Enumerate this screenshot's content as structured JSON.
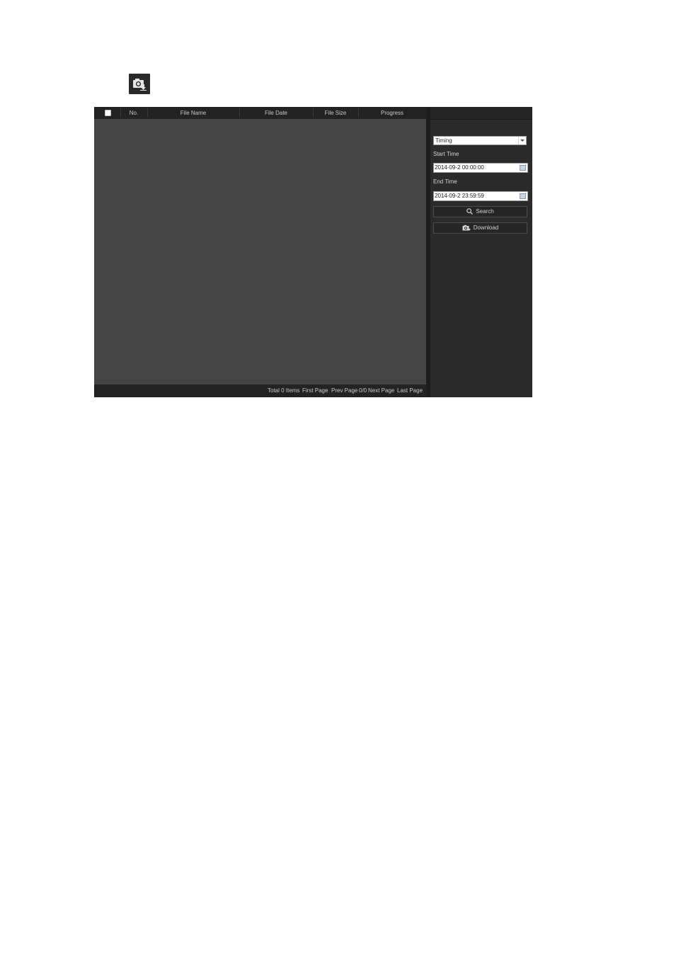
{
  "toolbar": {
    "icon": "capture-download-icon"
  },
  "table": {
    "columns": [
      "No.",
      "File Name",
      "File Date",
      "File Size",
      "Progress"
    ],
    "rows": []
  },
  "pager": {
    "total": "Total 0 Items",
    "first": "First Page",
    "prev": "Prev Page",
    "page": "0/0",
    "next": "Next Page",
    "last": "Last Page"
  },
  "search_panel": {
    "type_selected": "Timing",
    "start_label": "Start Time",
    "start_value": "2014-09-2 00:00:00",
    "end_label": "End Time",
    "end_value": "2014-09-2 23:59:59",
    "search_label": "Search",
    "download_label": "Download"
  },
  "colors": {
    "panel": "#2b2b2b",
    "list": "#444444",
    "header": "#232323"
  }
}
